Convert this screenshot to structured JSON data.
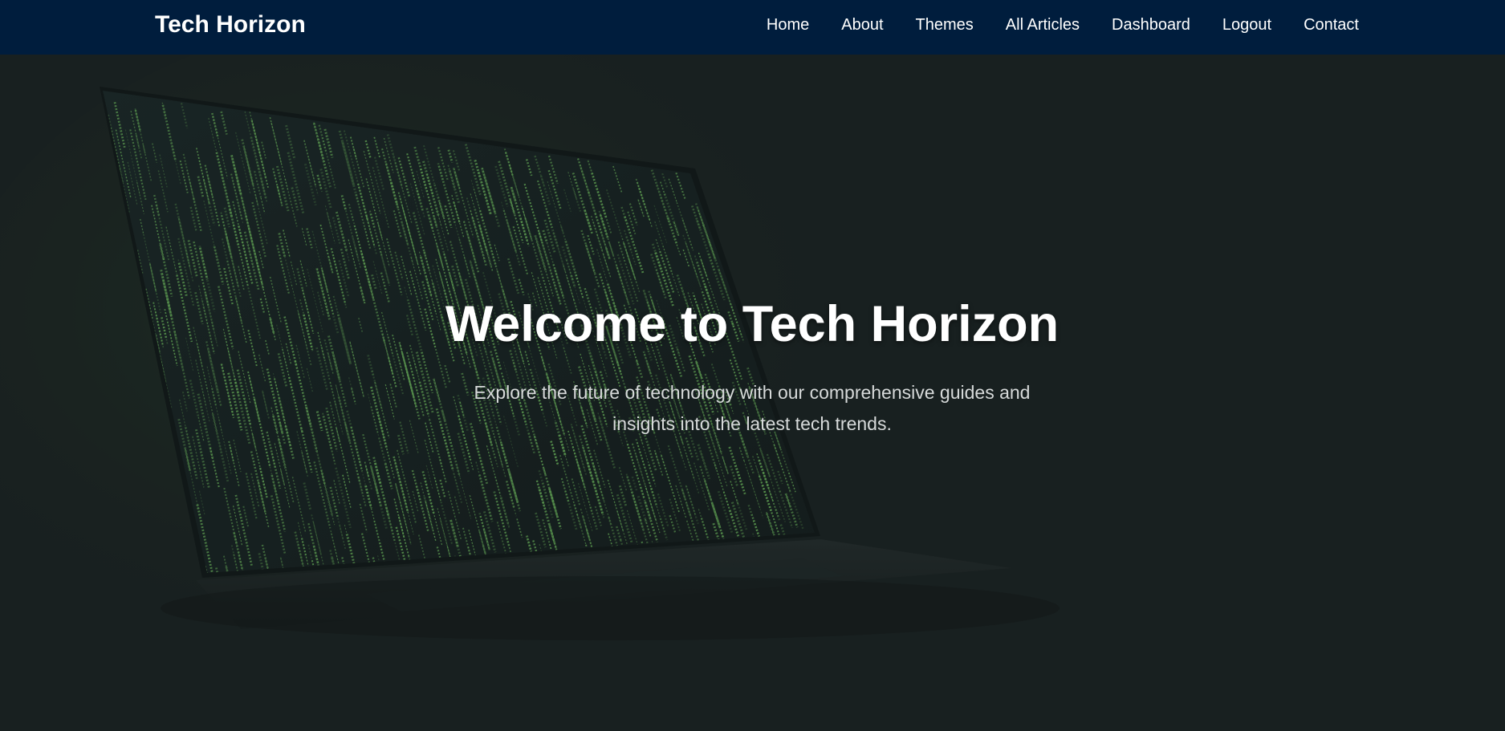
{
  "navbar": {
    "brand": "Tech Horizon",
    "links": [
      {
        "label": "Home"
      },
      {
        "label": "About"
      },
      {
        "label": "Themes"
      },
      {
        "label": "All Articles"
      },
      {
        "label": "Dashboard"
      },
      {
        "label": "Logout"
      },
      {
        "label": "Contact"
      }
    ]
  },
  "hero": {
    "title": "Welcome to Tech Horizon",
    "subtitle": "Explore the future of technology with our comprehensive guides and insights into the latest tech trends."
  },
  "colors": {
    "navbar_bg": "#001d3d",
    "hero_bg": "#1b2222",
    "code_green": "#7fd86a"
  }
}
